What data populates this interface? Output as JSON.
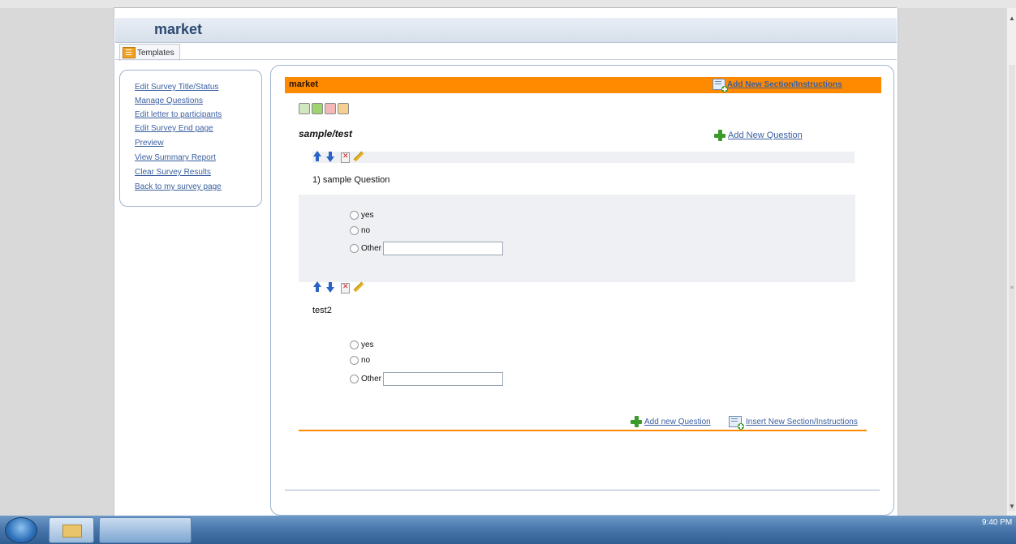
{
  "site": {
    "title": "market",
    "tab_templates": "Templates"
  },
  "nav": {
    "links": [
      "Edit Survey Title/Status",
      "Manage Questions",
      "Edit letter to participants",
      "Edit Survey End page",
      "Preview",
      "View Summary Report",
      "Clear Survey Results",
      "Back to my survey page"
    ]
  },
  "section": {
    "bar_title": "market",
    "add_section_link": "Add New Section/Instructions",
    "name": "sample/test",
    "add_question_link": "Add New Question"
  },
  "questions": [
    {
      "text": "1) sample Question",
      "options": [
        "yes",
        "no",
        "Other"
      ]
    },
    {
      "text": "test2",
      "options": [
        "yes",
        "no",
        "Other"
      ]
    }
  ],
  "footer_links": {
    "add_question": "Add new Question",
    "insert_section": "Insert New Section/Instructions"
  },
  "taskbar": {
    "clock": "9:40 PM"
  },
  "colors": {
    "section_bar": "#ff8a00",
    "link": "#3a5fa0",
    "header_text": "#2e4a73"
  }
}
